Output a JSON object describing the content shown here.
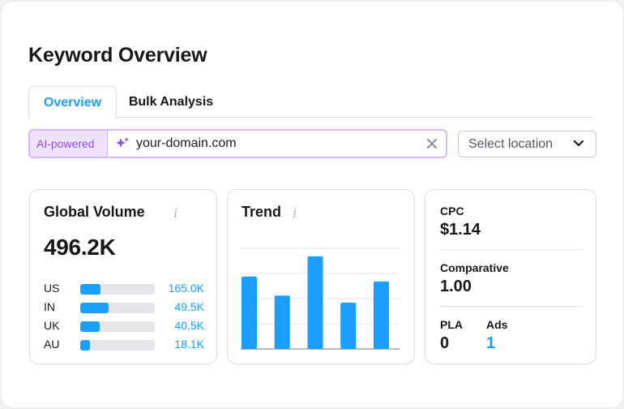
{
  "header": {
    "title": "Keyword Overview"
  },
  "tabs": [
    {
      "label": "Overview",
      "active": true
    },
    {
      "label": "Bulk Analysis",
      "active": false
    }
  ],
  "search": {
    "badge": "AI-powered",
    "value": "your-domain.com",
    "icon": "sparkle-icon",
    "clear_icon": "close-icon"
  },
  "location": {
    "placeholder": "Select location",
    "icon": "chevron-down-icon"
  },
  "volume": {
    "title": "Global Volume",
    "info": "i",
    "total": "496.2K",
    "countries": [
      {
        "code": "US",
        "value": "165.0K",
        "share": 0.27
      },
      {
        "code": "IN",
        "value": "49.5K",
        "share": 0.38
      },
      {
        "code": "UK",
        "value": "40.5K",
        "share": 0.26
      },
      {
        "code": "AU",
        "value": "18.1K",
        "share": 0.13
      }
    ]
  },
  "trend": {
    "title": "Trend",
    "info": "i",
    "chart_data": {
      "type": "bar",
      "values": [
        0.72,
        0.53,
        0.92,
        0.46,
        0.67
      ],
      "ylim": [
        0,
        1
      ],
      "grid": true
    }
  },
  "metrics": {
    "cpc": {
      "label": "CPC",
      "value": "$1.14"
    },
    "comparative": {
      "label": "Comparative",
      "value": "1.00"
    },
    "pla": {
      "label": "PLA",
      "value": "0"
    },
    "ads": {
      "label": "Ads",
      "value": "1"
    }
  },
  "colors": {
    "accent": "#1a9fff",
    "ai_purple": "#8e4fd6",
    "ai_bg": "#efe2fd"
  }
}
